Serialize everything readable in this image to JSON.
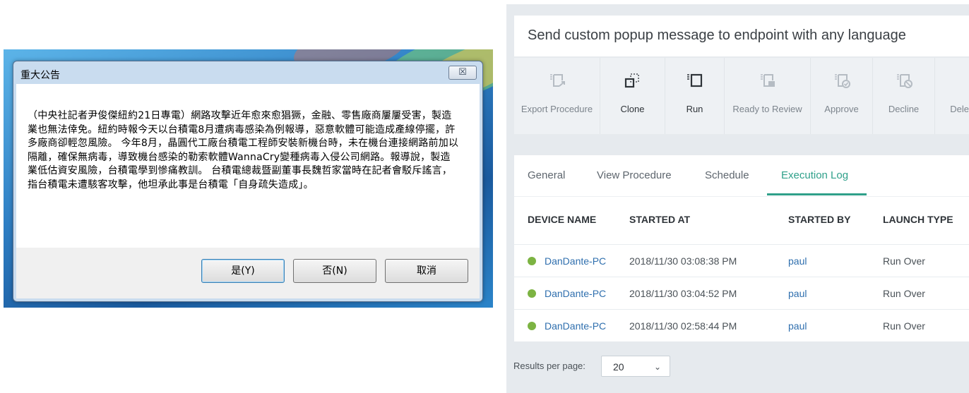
{
  "dialog": {
    "title": "重大公告",
    "close_label": "☒",
    "message": "（中央社記者尹俊傑紐約21日專電）網路攻擊近年愈來愈猖獗，金融、零售廠商屢屢受害，製造業也無法倖免。紐約時報今天以台積電8月遭病毒感染為例報導，惡意軟體可能造成產線停擺，許多廠商卻輕忽風險。 今年8月，晶圓代工廠台積電工程師安裝新機台時，未在機台連接網路前加以隔離，確保無病毒，導致機台感染的勒索軟體WannaCry變種病毒入侵公司網路。報導說，製造業低估資安風險，台積電學到慘痛教訓。 台積電總裁暨副董事長魏哲家當時在記者會駁斥謠言，指台積電未遭駭客攻擊，他坦承此事是台積電「自身疏失造成」。",
    "buttons": {
      "yes": "是(Y)",
      "no": "否(N)",
      "cancel": "取消"
    }
  },
  "panel": {
    "title": "Send custom popup message to endpoint with any language",
    "toolbar": {
      "export": "Export Procedure",
      "clone": "Clone",
      "run": "Run",
      "ready": "Ready to Review",
      "approve": "Approve",
      "decline": "Decline",
      "delete": "Delete"
    },
    "tabs": [
      "General",
      "View Procedure",
      "Schedule",
      "Execution Log"
    ],
    "active_tab": "Execution Log",
    "columns": [
      "DEVICE NAME",
      "STARTED AT",
      "STARTED BY",
      "LAUNCH TYPE"
    ],
    "rows": [
      {
        "device": "DanDante-PC",
        "started_at": "2018/11/30 03:08:38 PM",
        "started_by": "paul",
        "launch_type": "Run Over",
        "status_color": "#7cb342"
      },
      {
        "device": "DanDante-PC",
        "started_at": "2018/11/30 03:04:52 PM",
        "started_by": "paul",
        "launch_type": "Run Over",
        "status_color": "#7cb342"
      },
      {
        "device": "DanDante-PC",
        "started_at": "2018/11/30 02:58:44 PM",
        "started_by": "paul",
        "launch_type": "Run Over",
        "status_color": "#7cb342"
      }
    ],
    "pager": {
      "label": "Results per page:",
      "value": "20",
      "chevron": "⌄"
    }
  },
  "colors": {
    "accent": "#2fa08a",
    "link": "#2f6fae",
    "status_ok": "#7cb342"
  },
  "icons": {
    "export": "export-procedure-icon",
    "clone": "clone-icon",
    "run": "run-icon",
    "ready": "ready-to-review-icon",
    "approve": "approve-icon",
    "decline": "decline-icon"
  }
}
